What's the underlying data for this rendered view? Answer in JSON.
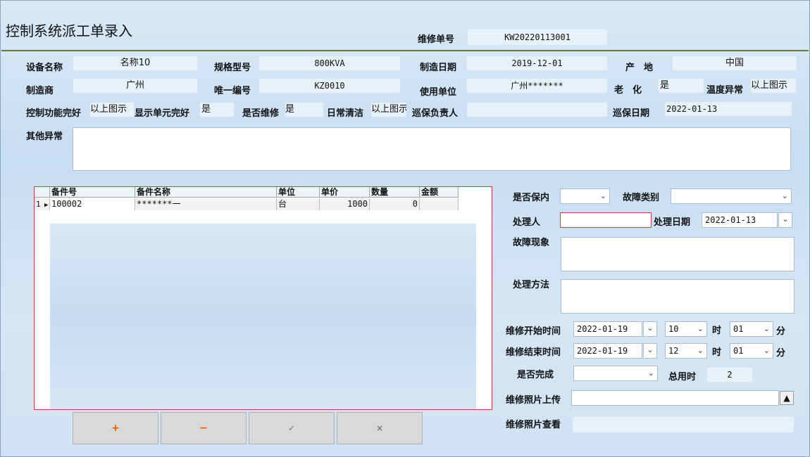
{
  "window": {
    "title": "控制系统派工单录入"
  },
  "header": {
    "order_no_label": "维修单号",
    "order_no": "KW20220113001"
  },
  "info": {
    "device_name_label": "设备名称",
    "device_name": "名称10",
    "model_label": "规格型号",
    "model": "800KVA",
    "mfg_date_label": "制造日期",
    "mfg_date": "2019-12-01",
    "origin_label": "产　地",
    "origin": "中国",
    "maker_label": "制造商",
    "maker": "广州",
    "serial_label": "唯一编号",
    "serial": "KZ0010",
    "user_unit_label": "使用单位",
    "user_unit": "广州*******",
    "aging_label": "老　化",
    "aging": "是",
    "temp_label": "温度异常",
    "temp": "以上图示",
    "ctrl_ok_label": "控制功能完好",
    "ctrl_ok": "以上图示",
    "display_ok_label": "显示单元完好",
    "display_ok": "是",
    "repaired_label": "是否维修",
    "repaired": "是",
    "cleaning_label": "日常清洁",
    "cleaning": "以上图示",
    "inspector_label": "巡保负责人",
    "inspector": "",
    "inspect_date_label": "巡保日期",
    "inspect_date": "2022-01-13",
    "other_label": "其他异常",
    "other": ""
  },
  "parts_table": {
    "headers": [
      "备件号",
      "备件名称",
      "单位",
      "单价",
      "数量",
      "金额"
    ],
    "rows": [
      {
        "index": "1",
        "part_no": "100002",
        "name": "*******一",
        "unit": "台",
        "price": "1000",
        "qty": "0",
        "amount": ""
      }
    ]
  },
  "buttons": {
    "add": "+",
    "remove": "−",
    "confirm": "✓",
    "cancel": "×"
  },
  "form": {
    "warranty_label": "是否保内",
    "warranty": "",
    "fault_type_label": "故障类别",
    "fault_type": "",
    "handler_label": "处理人",
    "handler": "",
    "handle_date_label": "处理日期",
    "handle_date": "2022-01-13",
    "fault_desc_label": "故障现象",
    "method_label": "处理方法",
    "start_label": "维修开始时间",
    "start_date": "2022-01-19",
    "start_hour": "10",
    "start_min": "01",
    "end_label": "维修结束时间",
    "end_date": "2022-01-19",
    "end_hour": "12",
    "end_min": "01",
    "hour_unit": "时",
    "min_unit": "分",
    "done_label": "是否完成",
    "done": "",
    "total_label": "总用时",
    "total": "2",
    "photo_up_label": "维修照片上传",
    "photo_up": "",
    "photo_view_label": "维修照片查看",
    "photo_view": ""
  },
  "icons": {
    "chevron": "chevron-down-icon",
    "upload": "upload-icon"
  }
}
